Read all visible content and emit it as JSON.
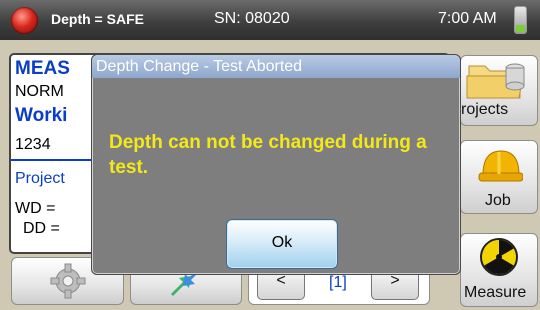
{
  "status_bar": {
    "depth_status": "Depth = SAFE",
    "serial": "SN: 08020",
    "time": "7:00 AM",
    "battery_icon": "battery-icon"
  },
  "main": {
    "heading": "MEAS",
    "mode": "NORM",
    "working_label": "Worki",
    "working_value": "1234",
    "project_label": "Project",
    "wd_label": "WD =",
    "dd_label": "DD ="
  },
  "side_buttons": {
    "projects_label": "rojects",
    "job_label": "Job",
    "measure_label": "Measure"
  },
  "bottom_bar": {
    "settings_icon": "gear-icon",
    "export_icon": "arrow-export-icon",
    "prev_label": "<",
    "page_label": "[1]",
    "next_label": ">"
  },
  "dialog": {
    "title": "Depth Change - Test Aborted",
    "message": "Depth can not be changed during a test.",
    "ok_label": "Ok"
  },
  "colors": {
    "accent_blue": "#0a3ec8",
    "warning_yellow": "#f2e81a",
    "dialog_gray": "#7e7e7e"
  }
}
